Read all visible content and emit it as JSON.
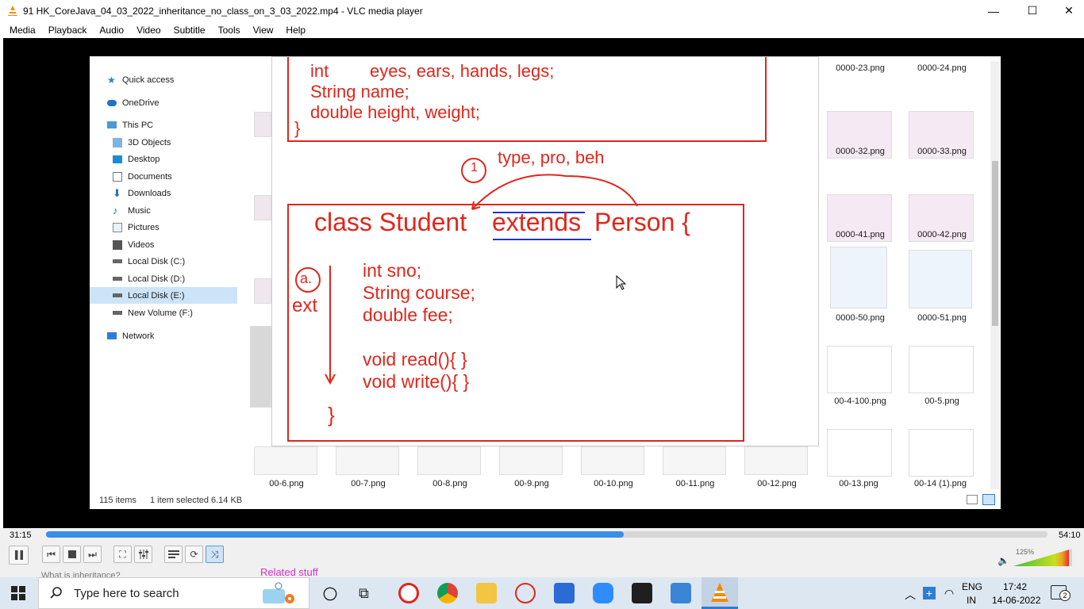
{
  "window": {
    "title": "91 HK_CoreJava_04_03_2022_inheritance_no_class_on_3_03_2022.mp4 - VLC media player",
    "minimize": "—",
    "maximize": "☐",
    "close": "✕"
  },
  "menu": [
    "Media",
    "Playback",
    "Audio",
    "Video",
    "Subtitle",
    "Tools",
    "View",
    "Help"
  ],
  "explorer": {
    "nav": [
      {
        "label": "Quick access",
        "icon": "star-icon"
      },
      {
        "label": "OneDrive",
        "icon": "cloud-icon"
      },
      {
        "label": "This PC",
        "icon": "pc-icon"
      },
      {
        "label": "3D Objects",
        "icon": "cube-icon"
      },
      {
        "label": "Desktop",
        "icon": "desktop-icon"
      },
      {
        "label": "Documents",
        "icon": "document-icon"
      },
      {
        "label": "Downloads",
        "icon": "download-icon"
      },
      {
        "label": "Music",
        "icon": "music-icon"
      },
      {
        "label": "Pictures",
        "icon": "picture-icon"
      },
      {
        "label": "Videos",
        "icon": "video-icon"
      },
      {
        "label": "Local Disk (C:)",
        "icon": "drive-icon"
      },
      {
        "label": "Local Disk (D:)",
        "icon": "drive-icon"
      },
      {
        "label": "Local Disk (E:)",
        "icon": "drive-icon"
      },
      {
        "label": "New Volume (F:)",
        "icon": "drive-icon"
      },
      {
        "label": "Network",
        "icon": "network-icon"
      }
    ],
    "right_thumbs": [
      "0000-23.png",
      "0000-24.png",
      "0000-32.png",
      "0000-33.png",
      "0000-41.png",
      "0000-42.png",
      "0000-50.png",
      "0000-51.png",
      "00-4-100.png",
      "00-5.png"
    ],
    "bottom_thumbs": [
      "00-6.png",
      "00-7.png",
      "00-8.png",
      "00-9.png",
      "00-10.png",
      "00-11.png",
      "00-12.png",
      "00-13.png",
      "00-14 (1).png"
    ],
    "status_items": "115 items",
    "status_selected": "1 item selected",
    "status_size": "6.14 KB"
  },
  "slide": {
    "top_line1_a": "int",
    "top_line1_b": "eyes, ears, hands, legs;",
    "top_line2": "String  name;",
    "top_line3": "double height, weight;",
    "top_brace": "}",
    "annot_num": "1",
    "annot_text": "type, pro, beh",
    "class_a": "class Student",
    "class_b": "extends",
    "class_c": "Person {",
    "side_a": "a.",
    "side_b": "ext",
    "body": [
      "int sno;",
      "String course;",
      "double fee;",
      "",
      "void read(){  }",
      "void write(){ }"
    ],
    "close_brace": "}"
  },
  "player": {
    "elapsed": "31:15",
    "total": "54:10",
    "progress": 0.577,
    "volume_label": "125%"
  },
  "overlay": {
    "behind_text": "What is inheritance?",
    "related": "Related stuff"
  },
  "taskbar": {
    "search_placeholder": "Type here to search",
    "lang1": "ENG",
    "lang2": "IN",
    "time": "17:42",
    "date": "14-06-2022",
    "notif_count": "2"
  }
}
